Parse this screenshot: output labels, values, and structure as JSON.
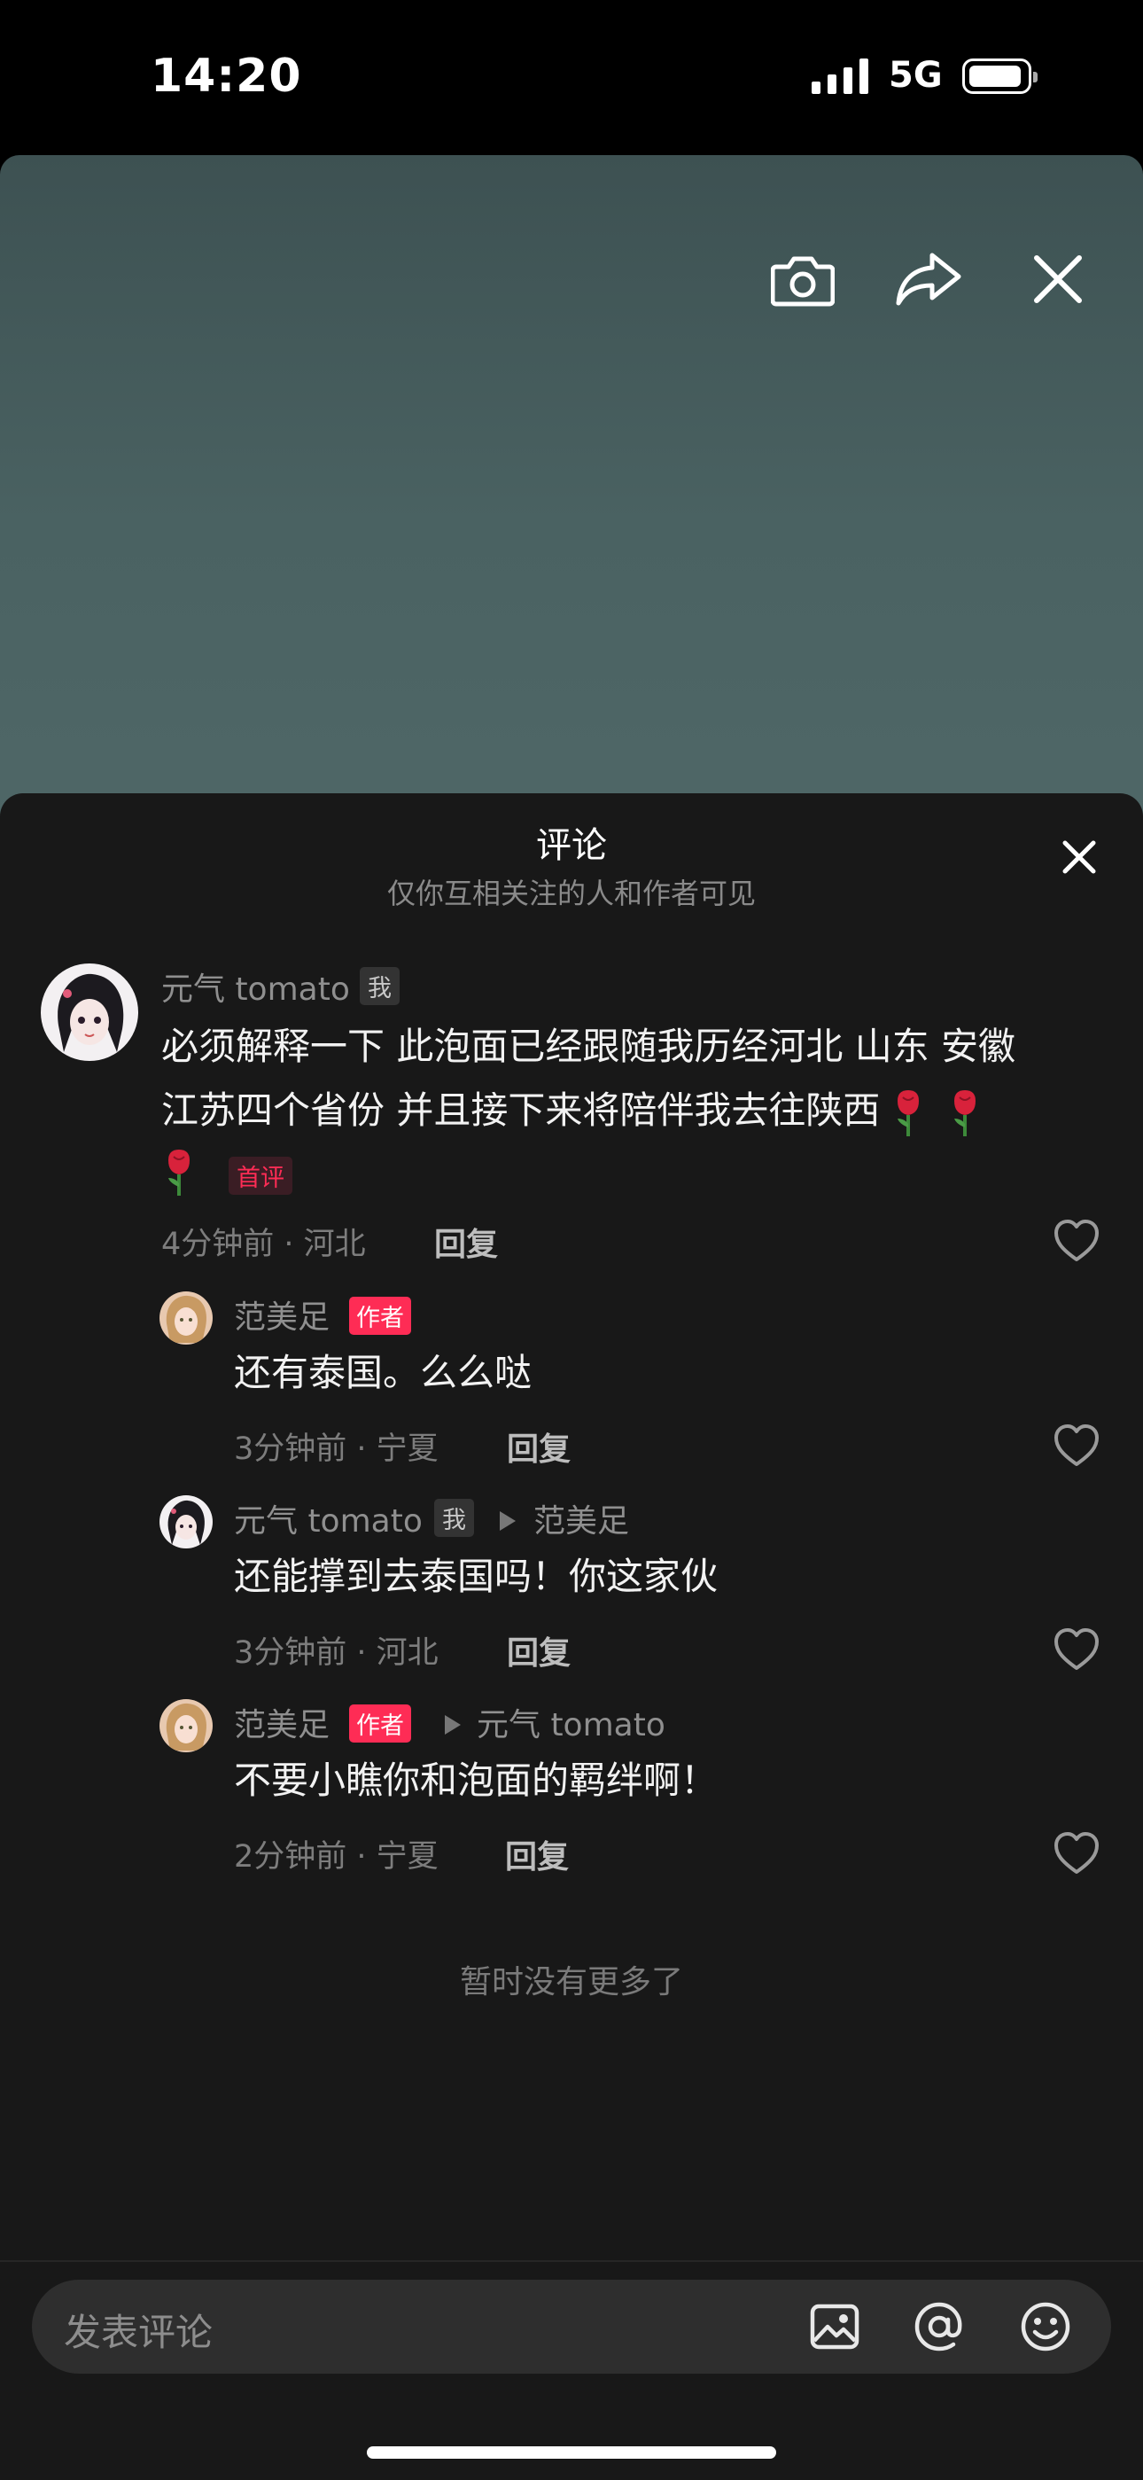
{
  "status_bar": {
    "time": "14:20",
    "network": "5G"
  },
  "sheet": {
    "title": "评论",
    "subtitle": "仅你互相关注的人和作者可见",
    "end_text": "暂时没有更多了"
  },
  "comment": {
    "username": "元气 tomato",
    "me_tag": "我",
    "line1": "必须解释一下 此泡面已经跟随我历经河北 山东 安徽",
    "line2": "江苏四个省份 并且接下来将陪伴我去往陕西",
    "first_tag": "首评",
    "meta": "4分钟前 · 河北",
    "reply_label": "回复"
  },
  "replies": [
    {
      "username": "范美足",
      "author_tag": "作者",
      "text": "还有泰国。么么哒",
      "meta": "3分钟前 · 宁夏",
      "reply_label": "回复"
    },
    {
      "username": "元气 tomato",
      "me_tag": "我",
      "reply_to": "范美足",
      "text": "还能撑到去泰国吗！你这家伙",
      "meta": "3分钟前 · 河北",
      "reply_label": "回复"
    },
    {
      "username": "范美足",
      "author_tag": "作者",
      "reply_to": "元气 tomato",
      "text": "不要小瞧你和泡面的羁绊啊！",
      "meta": "2分钟前 · 宁夏",
      "reply_label": "回复"
    }
  ],
  "input": {
    "placeholder": "发表评论"
  },
  "icons": {
    "camera": "camera-icon",
    "share": "share-icon",
    "close": "close-icon",
    "heart": "heart-icon",
    "rose": "rose-emoji-icon",
    "image": "image-icon",
    "mention": "at-mention-icon",
    "emoji": "emoji-icon"
  },
  "colors": {
    "accent": "#fe2c55",
    "sheet_bg": "#181818",
    "video_bg": "#4a6262"
  }
}
